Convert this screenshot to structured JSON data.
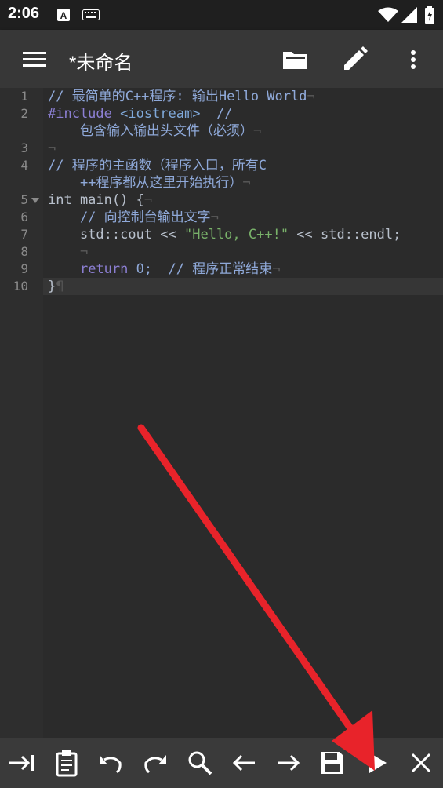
{
  "status": {
    "time": "2:06"
  },
  "app_bar": {
    "title": "*未命名",
    "icons": [
      "menu-icon",
      "folder-icon",
      "pencil-icon",
      "more-vert-icon"
    ]
  },
  "editor": {
    "line_numbers": [
      "1",
      "2",
      "3",
      "4",
      "5",
      "6",
      "7",
      "8",
      "9",
      "10"
    ],
    "lines": {
      "l1": "// 最简单的C++程序: 输出Hello World",
      "l2a": "#include ",
      "l2b": "<iostream>",
      "l2c": "  //",
      "l2d": "    包含输入输出头文件（必须）",
      "l3": "",
      "l4a": "// 程序的主函数（程序入口，所有C",
      "l4b": "    ++程序都从这里开始执行）",
      "l5a": "int main() {",
      "l6": "    // 向控制台输出文字",
      "l7a": "    std::cout << ",
      "l7b": "\"Hello, C++!\"",
      "l7c": " << std::endl;",
      "l8": "    ",
      "l9a": "    ",
      "l9b": "return",
      "l9c": " 0;  // 程序正常结束",
      "l10": "}"
    }
  },
  "bottom_bar": {
    "buttons": [
      "tab-icon",
      "paste-icon",
      "undo-icon",
      "redo-icon",
      "search-icon",
      "left-arrow-icon",
      "right-arrow-icon",
      "save-icon",
      "run-icon",
      "close-icon"
    ]
  },
  "colors": {
    "arrow": "#e8232a",
    "background": "#2b2b2b",
    "appbar": "#373737"
  }
}
